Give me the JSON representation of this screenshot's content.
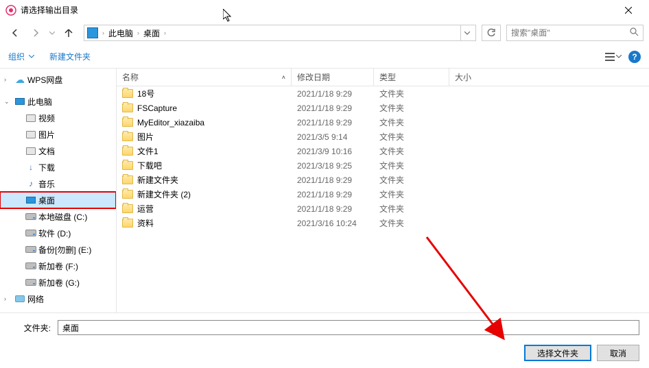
{
  "title": "请选择输出目录",
  "breadcrumb": {
    "segments": [
      "此电脑",
      "桌面"
    ]
  },
  "search": {
    "placeholder": "搜索\"桌面\""
  },
  "toolbar": {
    "organize": "组织",
    "new_folder": "新建文件夹"
  },
  "tree": {
    "items": [
      {
        "label": "WPS网盘",
        "level": 0,
        "icon": "cloud",
        "expandable": true,
        "expanded": false
      },
      {
        "label": "此电脑",
        "level": 0,
        "icon": "pc",
        "expandable": true,
        "expanded": true
      },
      {
        "label": "视频",
        "level": 1,
        "icon": "lib"
      },
      {
        "label": "图片",
        "level": 1,
        "icon": "lib"
      },
      {
        "label": "文档",
        "level": 1,
        "icon": "lib"
      },
      {
        "label": "下载",
        "level": 1,
        "icon": "dl"
      },
      {
        "label": "音乐",
        "level": 1,
        "icon": "music"
      },
      {
        "label": "桌面",
        "level": 1,
        "icon": "desktop",
        "selected": true,
        "highlight": true
      },
      {
        "label": "本地磁盘 (C:)",
        "level": 1,
        "icon": "disk"
      },
      {
        "label": "软件 (D:)",
        "level": 1,
        "icon": "disk"
      },
      {
        "label": "备份[勿删] (E:)",
        "level": 1,
        "icon": "disk"
      },
      {
        "label": "新加卷 (F:)",
        "level": 1,
        "icon": "disk"
      },
      {
        "label": "新加卷 (G:)",
        "level": 1,
        "icon": "disk"
      },
      {
        "label": "网络",
        "level": 0,
        "icon": "net",
        "expandable": true,
        "expanded": false
      }
    ],
    "spacer_after": [
      0,
      13
    ]
  },
  "columns": {
    "name": "名称",
    "date": "修改日期",
    "type": "类型",
    "size": "大小"
  },
  "rows": [
    {
      "name": "18号",
      "date": "2021/1/18 9:29",
      "type": "文件夹"
    },
    {
      "name": "FSCapture",
      "date": "2021/1/18 9:29",
      "type": "文件夹"
    },
    {
      "name": "MyEditor_xiazaiba",
      "date": "2021/1/18 9:29",
      "type": "文件夹"
    },
    {
      "name": "图片",
      "date": "2021/3/5 9:14",
      "type": "文件夹"
    },
    {
      "name": "文件1",
      "date": "2021/3/9 10:16",
      "type": "文件夹"
    },
    {
      "name": "下载吧",
      "date": "2021/3/18 9:25",
      "type": "文件夹"
    },
    {
      "name": "新建文件夹",
      "date": "2021/1/18 9:29",
      "type": "文件夹"
    },
    {
      "name": "新建文件夹 (2)",
      "date": "2021/1/18 9:29",
      "type": "文件夹"
    },
    {
      "name": "运营",
      "date": "2021/1/18 9:29",
      "type": "文件夹"
    },
    {
      "name": "资料",
      "date": "2021/3/16 10:24",
      "type": "文件夹"
    }
  ],
  "bottom": {
    "folder_label": "文件夹:",
    "folder_value": "桌面",
    "select_btn": "选择文件夹",
    "cancel_btn": "取消"
  }
}
